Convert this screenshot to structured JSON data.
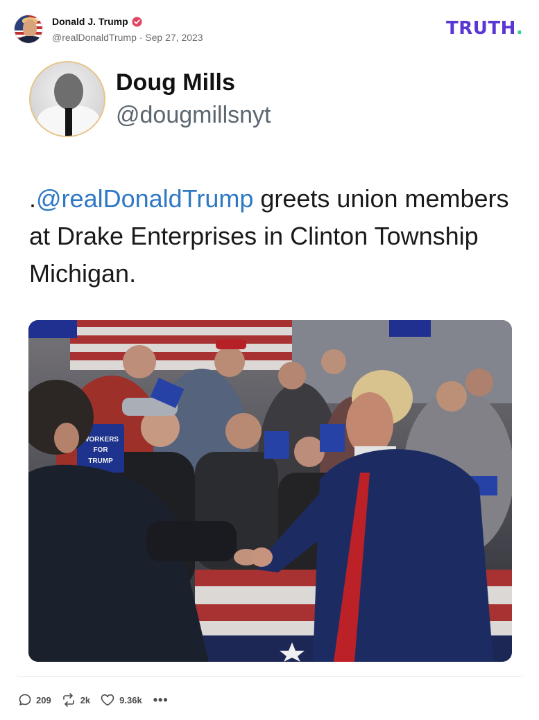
{
  "post": {
    "author_name": "Donald J. Trump",
    "author_meta": "@realDonaldTrump · Sep 27, 2023",
    "brand_text": "TRUTH",
    "brand_dot": ".",
    "quoted": {
      "name": "Doug Mills",
      "handle": "@dougmillsnyt",
      "text_prefix": ".",
      "mention": "@realDonaldTrump",
      "text_rest": " greets union members at Drake Enterprises in Clinton Township Michigan."
    },
    "photo": {
      "sign_texts": [
        "WORKERS",
        "FOR",
        "TRUMP"
      ]
    }
  },
  "actions": {
    "replies": "209",
    "retruths": "2k",
    "likes": "9.36k",
    "more": "•••"
  },
  "colors": {
    "brand": "#5a37d4",
    "brand_dot": "#2fd1a1",
    "mention": "#2f78c4",
    "verified": "#e0445e"
  },
  "icons": [
    "verified-badge-icon",
    "reply-icon",
    "retruth-icon",
    "like-icon",
    "more-icon"
  ]
}
